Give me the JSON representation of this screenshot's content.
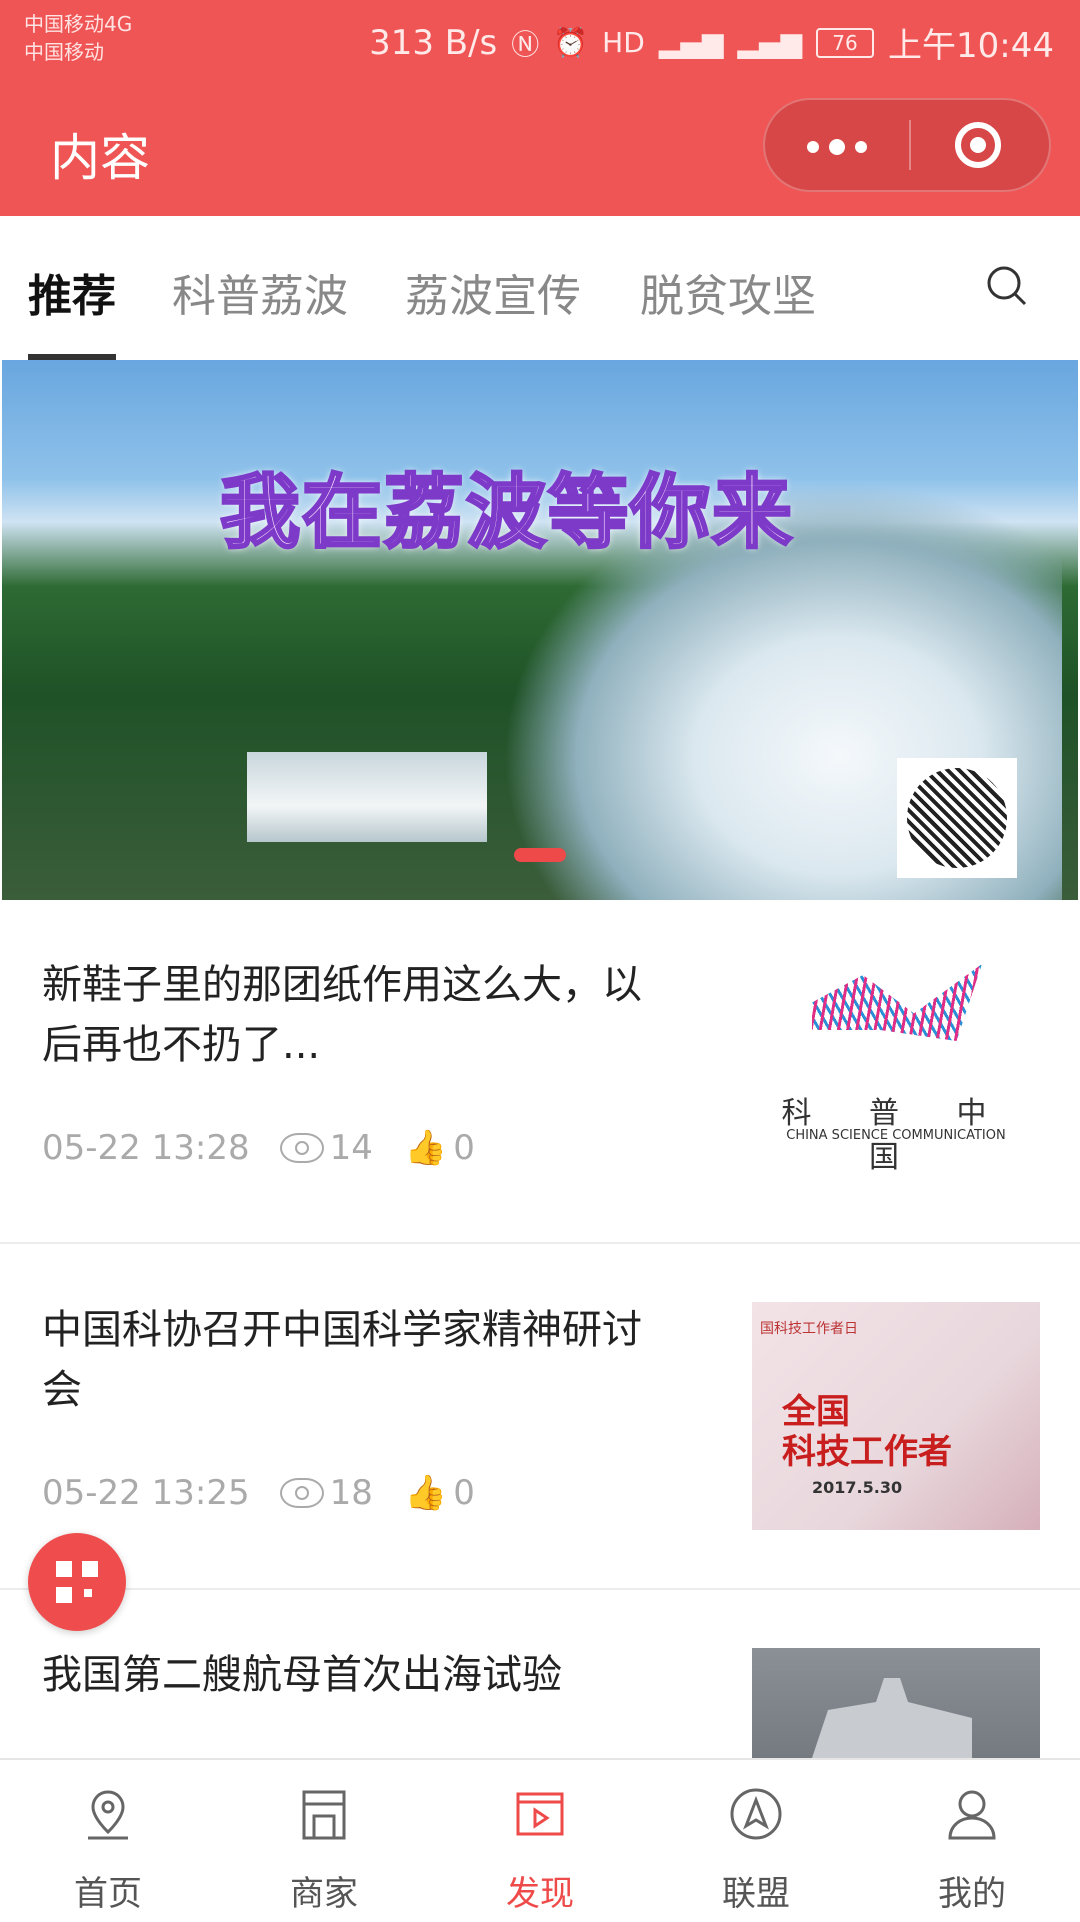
{
  "status_bar": {
    "carrier_line1": "中国移动4G",
    "carrier_line2": "中国移动",
    "speed": "313 B/s",
    "hd_badge": "HD",
    "battery": "76",
    "time": "上午10:44"
  },
  "header": {
    "title": "内容"
  },
  "tabs": [
    {
      "label": "推荐",
      "active": true
    },
    {
      "label": "科普荔波"
    },
    {
      "label": "荔波宣传"
    },
    {
      "label": "脱贫攻坚"
    }
  ],
  "banner": {
    "headline": "我在荔波等你来"
  },
  "articles": [
    {
      "title": "新鞋子里的那团纸作用这么大，以后再也不扔了...",
      "date": "05-22 13:28",
      "views": "14",
      "likes": "0",
      "thumb_text_cn": "科 普 中 国",
      "thumb_text_en": "CHINA SCIENCE COMMUNICATION"
    },
    {
      "title": "中国科协召开中国科学家精神研讨会",
      "date": "05-22 13:25",
      "views": "18",
      "likes": "0",
      "thumb_text_top": "国科技工作者日",
      "thumb_text_main": "全国\n科技工作者",
      "thumb_text_date": "2017.5.30"
    },
    {
      "title": "我国第二艘航母首次出海试验"
    }
  ],
  "bottom_nav": [
    {
      "label": "首页",
      "icon": "location-pin-icon"
    },
    {
      "label": "商家",
      "icon": "store-icon"
    },
    {
      "label": "发现",
      "icon": "play-video-icon",
      "active": true
    },
    {
      "label": "联盟",
      "icon": "compass-icon"
    },
    {
      "label": "我的",
      "icon": "user-icon"
    }
  ],
  "colors": {
    "brand": "#f05555",
    "active": "#ef4a4a"
  }
}
